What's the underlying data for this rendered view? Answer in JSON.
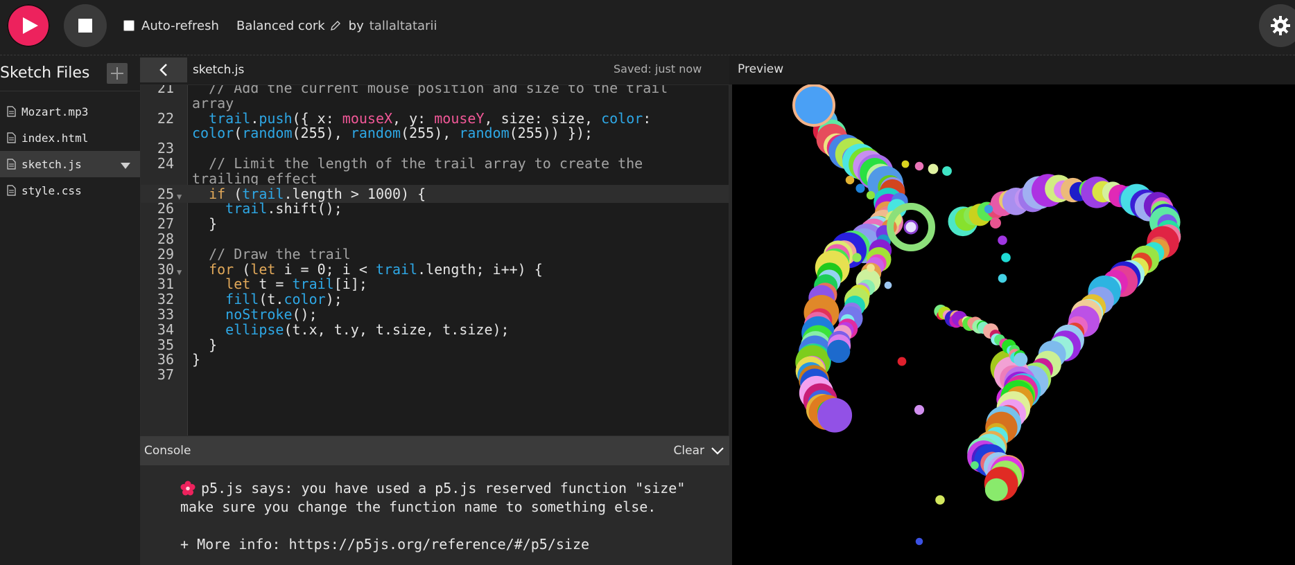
{
  "toolbar": {
    "auto_refresh_label": "Auto-refresh",
    "auto_refresh_checked": false,
    "sketch_name": "Balanced cork",
    "by_label": "by",
    "author": "tallaltatarii"
  },
  "colors": {
    "play": "#ed225d",
    "keyword": "#e2a95a",
    "function": "#2ea8e6",
    "p5_builtin": "#f25898",
    "comment": "#a3a3a3"
  },
  "sidebar": {
    "title": "Sketch Files",
    "files": [
      {
        "name": "Mozart.mp3",
        "active": false
      },
      {
        "name": "index.html",
        "active": false
      },
      {
        "name": "sketch.js",
        "active": true
      },
      {
        "name": "style.css",
        "active": false
      }
    ]
  },
  "editor": {
    "filename": "sketch.js",
    "saved_status": "Saved: just now",
    "lines": [
      {
        "n": "21",
        "text": "  // Add the current mouse position and size to the trail"
      },
      {
        "n": "",
        "text": "array"
      },
      {
        "n": "22",
        "text": "  trail.push({ x: mouseX, y: mouseY, size: size, color:"
      },
      {
        "n": "",
        "text": "color(random(255), random(255), random(255)) });"
      },
      {
        "n": "23",
        "text": ""
      },
      {
        "n": "24",
        "text": "  // Limit the length of the trail array to create the"
      },
      {
        "n": "",
        "text": "trailing effect"
      },
      {
        "n": "25",
        "text": "  if (trail.length > 1000) {"
      },
      {
        "n": "26",
        "text": "    trail.shift();"
      },
      {
        "n": "27",
        "text": "  }"
      },
      {
        "n": "28",
        "text": ""
      },
      {
        "n": "29",
        "text": "  // Draw the trail"
      },
      {
        "n": "30",
        "text": "  for (let i = 0; i < trail.length; i++) {"
      },
      {
        "n": "31",
        "text": "    let t = trail[i];"
      },
      {
        "n": "32",
        "text": "    fill(t.color);"
      },
      {
        "n": "33",
        "text": "    noStroke();"
      },
      {
        "n": "34",
        "text": "    ellipse(t.x, t.y, t.size, t.size);"
      },
      {
        "n": "35",
        "text": "  }"
      },
      {
        "n": "36",
        "text": "}"
      },
      {
        "n": "37",
        "text": ""
      }
    ]
  },
  "console": {
    "title": "Console",
    "clear_label": "Clear",
    "message_line1": "p5.js says: you have used a p5.js reserved function \"size\"",
    "message_line2": "make sure you change the function name to something else.",
    "more_info_prefix": "+ More info: ",
    "more_info_url": "https://p5js.org/reference/#/p5/size"
  },
  "preview": {
    "label": "Preview"
  }
}
